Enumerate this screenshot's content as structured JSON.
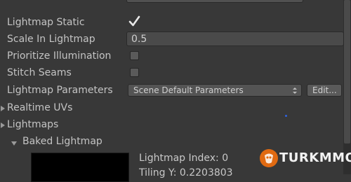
{
  "inspector": {
    "lightmap_static": {
      "label": "Lightmap Static",
      "checked": true
    },
    "scale_in_lightmap": {
      "label": "Scale In Lightmap",
      "value": "0.5"
    },
    "prioritize_illumination": {
      "label": "Prioritize Illumination",
      "checked": false
    },
    "stitch_seams": {
      "label": "Stitch Seams",
      "checked": false
    },
    "lightmap_parameters": {
      "label": "Lightmap Parameters",
      "value": "Scene Default Parameters",
      "edit_label": "Edit..."
    },
    "realtime_uvs": {
      "label": "Realtime UVs"
    },
    "lightmaps": {
      "label": "Lightmaps"
    },
    "baked_lightmap": {
      "label": "Baked Lightmap",
      "index_text": "Lightmap Index: 0",
      "tiling_text": "Tiling Y: 0.2203803"
    }
  },
  "watermark": {
    "text": "TURKMMO",
    "color": "#e06a12"
  },
  "icons": [
    "checkmark-icon",
    "foldout-arrow-icon",
    "dropdown-arrows-icon",
    "logo-icon"
  ]
}
